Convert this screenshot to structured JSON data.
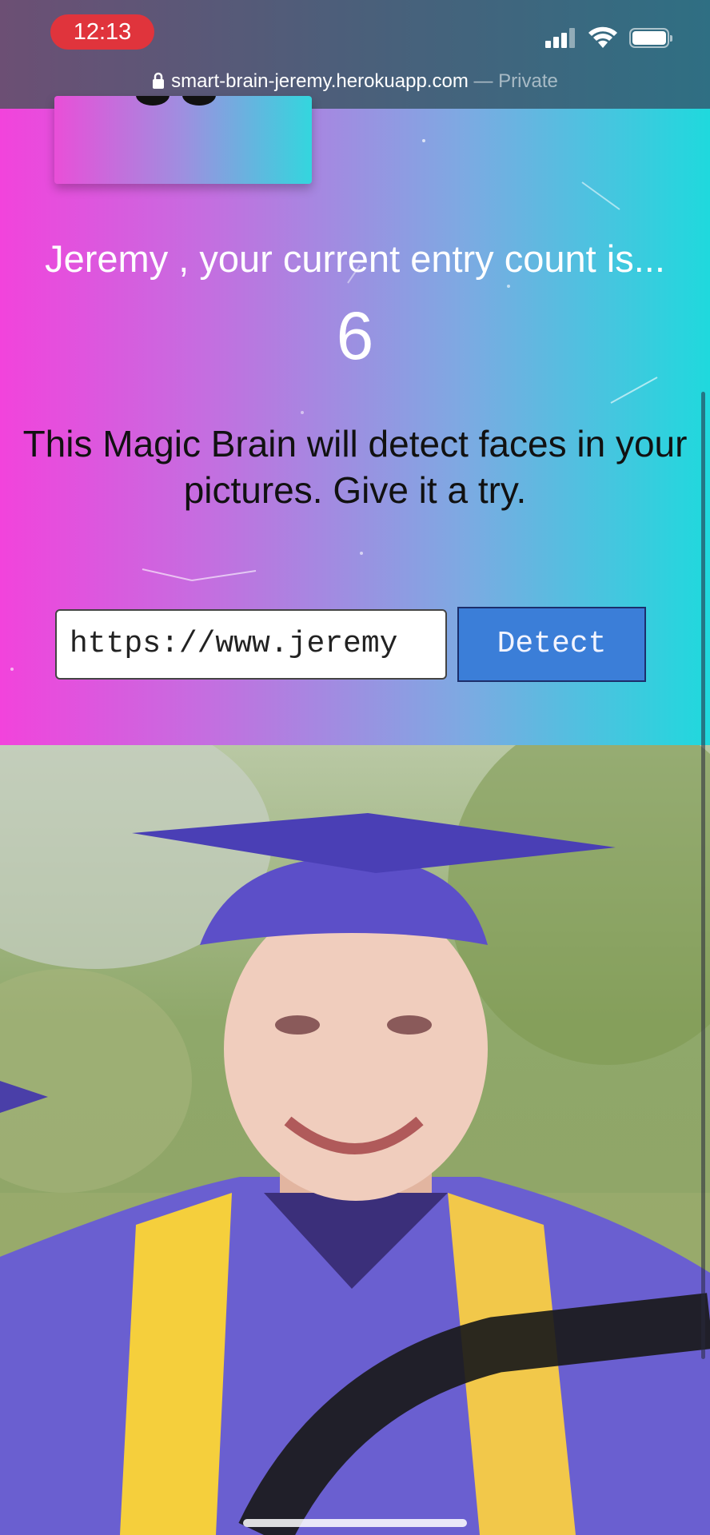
{
  "status_bar": {
    "time": "12:13"
  },
  "url_bar": {
    "domain": "smart-brain-jeremy.herokuapp.com",
    "mode": "— Private"
  },
  "rank": {
    "message": "Jeremy , your current entry count is...",
    "count": "6"
  },
  "intro": {
    "text": "This Magic Brain will detect faces in your pictures. Give it a try."
  },
  "form": {
    "url_value": "https://www.jeremy",
    "detect_label": "Detect"
  },
  "colors": {
    "gradient_start": "#f243dc",
    "gradient_end": "#1fd9dd",
    "detect_button": "#3b7ed8",
    "recording_pill": "#e0343c"
  },
  "icons": [
    "lock-icon",
    "signal-icon",
    "wifi-icon",
    "battery-icon"
  ]
}
